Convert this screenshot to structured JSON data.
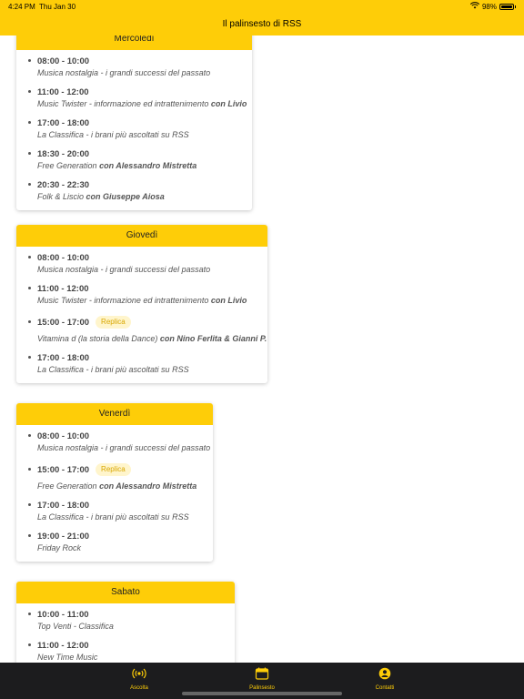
{
  "status": {
    "time": "4:24 PM",
    "date": "Thu Jan 30",
    "battery": "98%"
  },
  "header": {
    "title": "Il palinsesto di RSS"
  },
  "days": [
    {
      "name": "Mercoledì",
      "entries": [
        {
          "time": "08:00 - 10:00",
          "show": "Musica nostalgia - i grandi successi del passato"
        },
        {
          "time": "11:00 - 12:00",
          "show": "Music Twister - informazione ed intrattenimento",
          "host": "con Livio"
        },
        {
          "time": "17:00 - 18:00",
          "show": "La Classifica - i brani più ascoltati su RSS"
        },
        {
          "time": "18:30 - 20:00",
          "show": "Free Generation",
          "host": "con Alessandro Mistretta"
        },
        {
          "time": "20:30 - 22:30",
          "show": "Folk & Liscio",
          "host": "con Giuseppe Aiosa"
        }
      ]
    },
    {
      "name": "Giovedì",
      "entries": [
        {
          "time": "08:00 - 10:00",
          "show": "Musica nostalgia - i grandi successi del passato"
        },
        {
          "time": "11:00 - 12:00",
          "show": "Music Twister - informazione ed intrattenimento",
          "host": "con Livio"
        },
        {
          "time": "15:00 - 17:00",
          "badge": "Replica",
          "show": "Vitamina d (la storia della Dance)",
          "host": "con Nino Ferlita & Gianni P."
        },
        {
          "time": "17:00 - 18:00",
          "show": "La Classifica - i brani più ascoltati su RSS"
        }
      ]
    },
    {
      "name": "Venerdì",
      "entries": [
        {
          "time": "08:00 - 10:00",
          "show": "Musica nostalgia - i grandi successi del passato"
        },
        {
          "time": "15:00 - 17:00",
          "badge": "Replica",
          "show": "Free Generation",
          "host": "con Alessandro Mistretta"
        },
        {
          "time": "17:00 - 18:00",
          "show": "La Classifica - i brani più ascoltati su RSS"
        },
        {
          "time": "19:00 - 21:00",
          "show": "Friday Rock"
        }
      ]
    },
    {
      "name": "Sabato",
      "entries": [
        {
          "time": "10:00 - 11:00",
          "show": "Top Venti - Classifica"
        },
        {
          "time": "11:00 - 12:00",
          "show": "New Time Music"
        }
      ]
    }
  ],
  "tabs": [
    {
      "label": "Ascolta",
      "icon": "radio-broadcast-icon"
    },
    {
      "label": "Palinsesto",
      "icon": "calendar-icon"
    },
    {
      "label": "Contatti",
      "icon": "user-circle-icon"
    }
  ],
  "colors": {
    "accent": "#fecd08",
    "tabbar": "#1c1c1e",
    "badge_text": "#d9a700",
    "badge_bg": "#fff5cc"
  }
}
